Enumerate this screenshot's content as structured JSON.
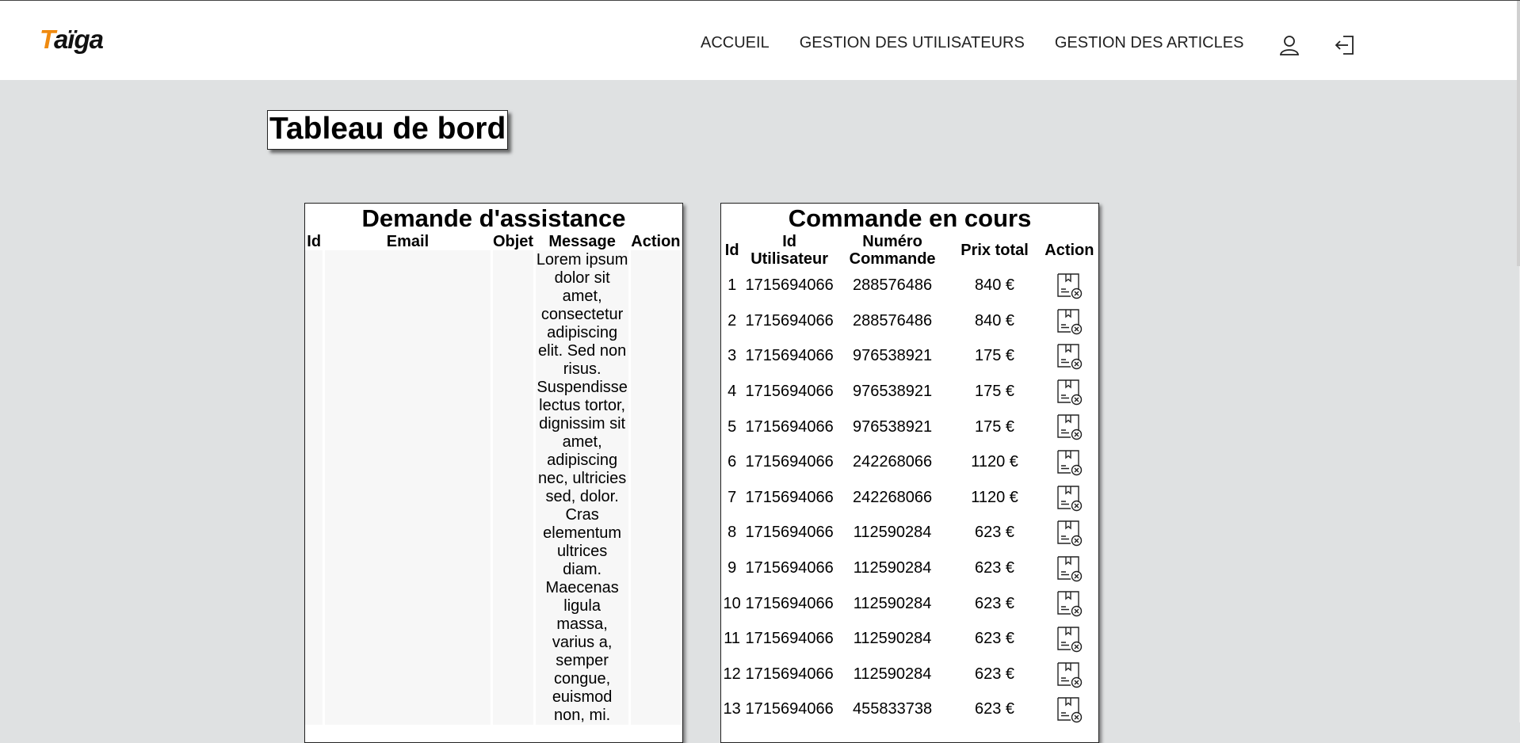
{
  "brand": {
    "logo_first": "T",
    "logo_rest": "aïga"
  },
  "nav": {
    "items": [
      {
        "label": "ACCUEIL"
      },
      {
        "label": "GESTION DES UTILISATEURS"
      },
      {
        "label": "GESTION DES ARTICLES"
      }
    ],
    "profile_icon": "user-icon",
    "logout_icon": "logout-icon"
  },
  "page_title": "Tableau de bord",
  "assistance": {
    "title": "Demande d'assistance",
    "columns": [
      "Id",
      "Email",
      "Objet",
      "Message",
      "Action"
    ],
    "rows": [
      {
        "id": "",
        "email": "",
        "objet": "",
        "message": "Lorem ipsum dolor sit amet, consectetur adipiscing elit. Sed non risus. Suspendisse lectus tortor, dignissim sit amet, adipiscing nec, ultricies sed, dolor. Cras elementum ultrices diam. Maecenas ligula massa, varius a, semper congue, euismod non, mi.",
        "action": ""
      }
    ]
  },
  "orders": {
    "title": "Commande en cours",
    "columns": [
      "Id",
      "Id Utilisateur",
      "Numéro Commande",
      "Prix total",
      "Action"
    ],
    "action_icon": "cancel-order-icon",
    "rows": [
      {
        "id": "1",
        "user": "1715694066",
        "number": "288576486",
        "total": "840 €"
      },
      {
        "id": "2",
        "user": "1715694066",
        "number": "288576486",
        "total": "840 €"
      },
      {
        "id": "3",
        "user": "1715694066",
        "number": "976538921",
        "total": "175 €"
      },
      {
        "id": "4",
        "user": "1715694066",
        "number": "976538921",
        "total": "175 €"
      },
      {
        "id": "5",
        "user": "1715694066",
        "number": "976538921",
        "total": "175 €"
      },
      {
        "id": "6",
        "user": "1715694066",
        "number": "242268066",
        "total": "1120 €"
      },
      {
        "id": "7",
        "user": "1715694066",
        "number": "242268066",
        "total": "1120 €"
      },
      {
        "id": "8",
        "user": "1715694066",
        "number": "112590284",
        "total": "623 €"
      },
      {
        "id": "9",
        "user": "1715694066",
        "number": "112590284",
        "total": "623 €"
      },
      {
        "id": "10",
        "user": "1715694066",
        "number": "112590284",
        "total": "623 €"
      },
      {
        "id": "11",
        "user": "1715694066",
        "number": "112590284",
        "total": "623 €"
      },
      {
        "id": "12",
        "user": "1715694066",
        "number": "112590284",
        "total": "623 €"
      },
      {
        "id": "13",
        "user": "1715694066",
        "number": "455833738",
        "total": "623 €"
      }
    ]
  }
}
